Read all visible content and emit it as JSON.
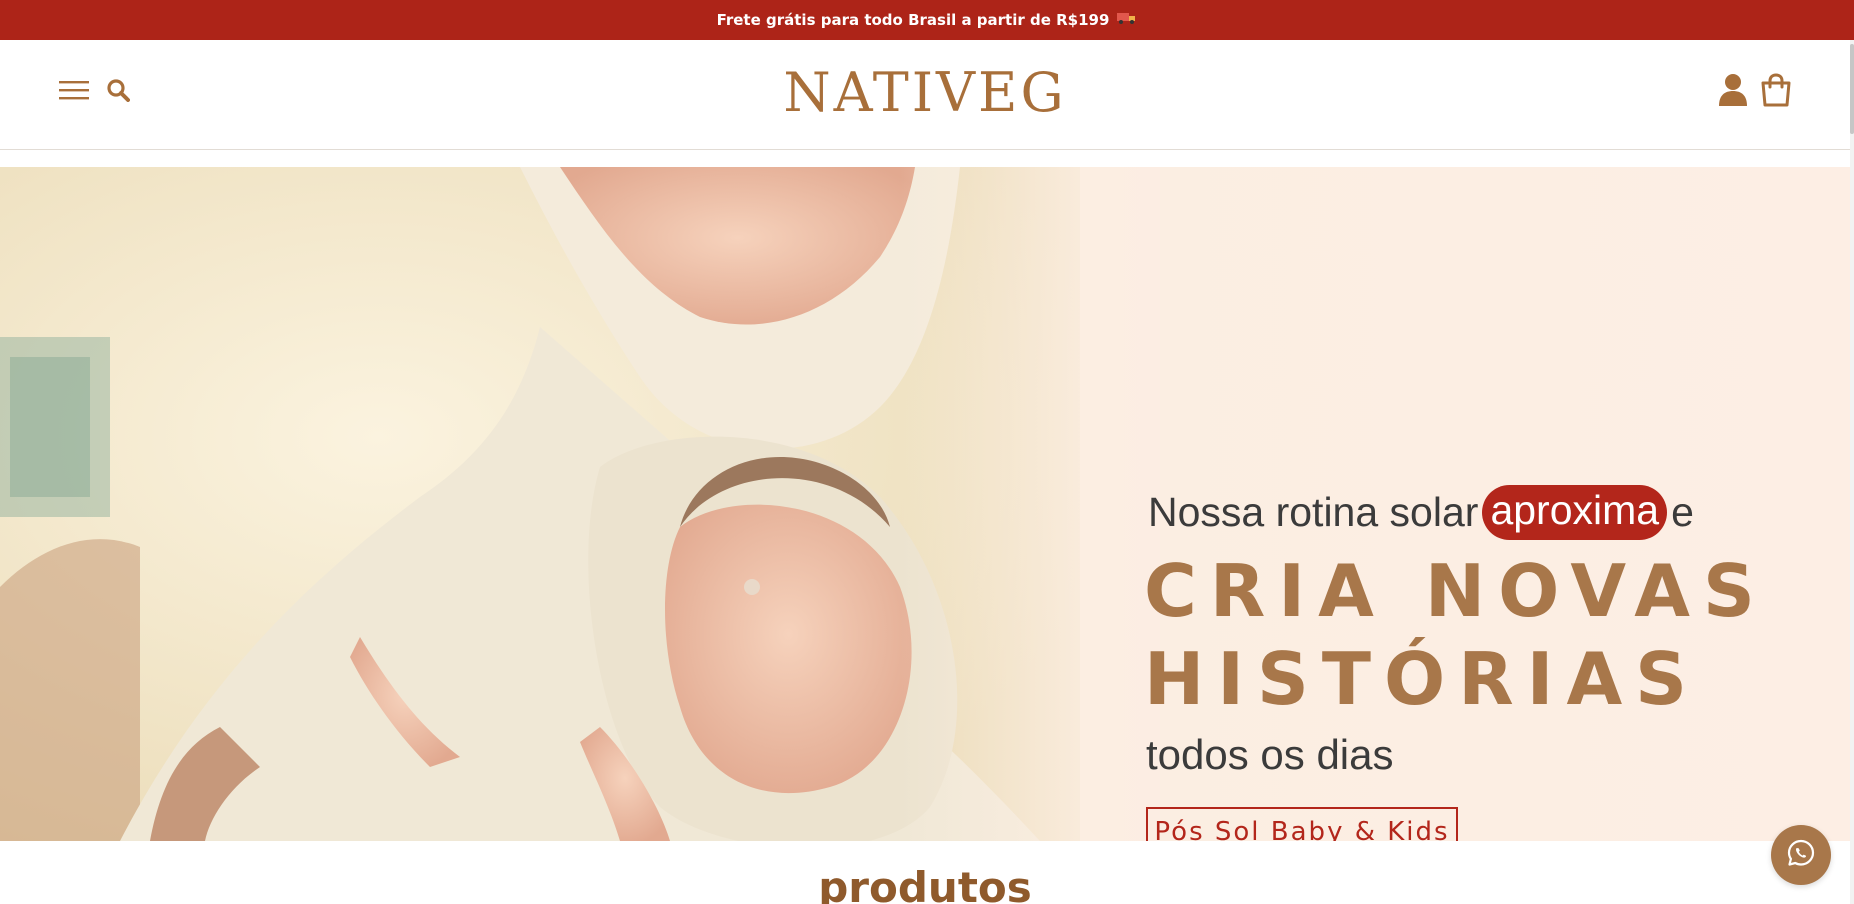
{
  "announcement": {
    "text": "Frete grátis para todo Brasil a partir de R$199",
    "icon": "truck-icon"
  },
  "header": {
    "logo_text": "NATIVEG",
    "icons": [
      "menu-icon",
      "search-icon",
      "user-icon",
      "cart-icon"
    ],
    "brand_color": "#a86f3a"
  },
  "hero": {
    "line1_before": "Nossa rotina solar",
    "line1_highlight": "aproxima",
    "line1_after": "e",
    "title_line1": "CRIA NOVAS",
    "title_line2": "HISTÓRIAS",
    "line3": "todos os dias",
    "cta_label": "Pós Sol Baby & Kids",
    "accent_color": "#b3261b",
    "title_color": "#a8774a"
  },
  "products_section": {
    "title": "produtos"
  },
  "floating": {
    "whatsapp_icon": "whatsapp-icon"
  },
  "colors": {
    "announcement_bg": "#ad2418",
    "background": "#ffffff"
  }
}
